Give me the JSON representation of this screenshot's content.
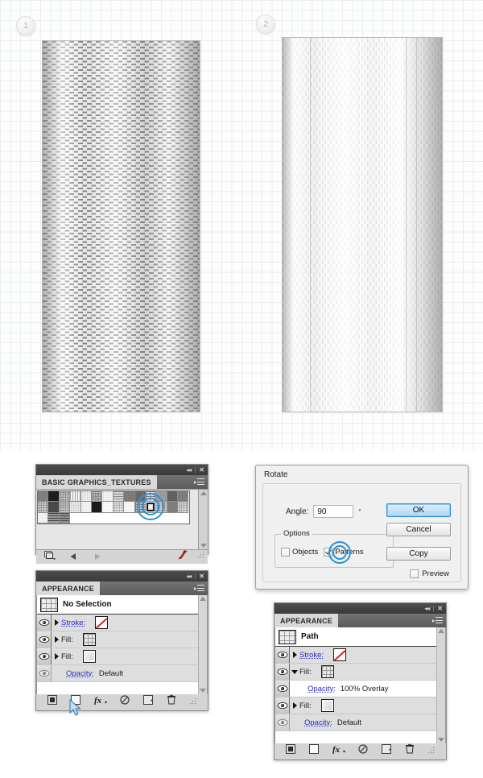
{
  "canvas": {
    "badges": [
      {
        "label": "1"
      },
      {
        "label": "2"
      }
    ],
    "artwork": [
      {
        "name": "textured-rectangle-original",
        "pattern": "horizontal-dashes"
      },
      {
        "name": "textured-rectangle-rotated",
        "pattern": "vertical-dashes"
      }
    ]
  },
  "swatch_panel": {
    "tab_label": "BASIC GRAPHICS_TEXTURES",
    "collapse_icon": "collapse-icon",
    "close_icon": "close-icon",
    "menu_icon": "panel-menu-icon",
    "footer": {
      "library_icon": "swatch-libraries-icon",
      "prev_icon": "previous-arrow-icon",
      "next_icon": "next-arrow-icon",
      "delete_icon": "delete-brush-icon"
    },
    "scroll": {
      "up_icon": "scroll-up-arrow",
      "down_icon": "scroll-down-arrow"
    },
    "selected_swatch_index": 24,
    "swatch_count": 31
  },
  "appearance_left": {
    "tab_label": "APPEARANCE",
    "collapse_icon": "collapse-icon",
    "close_icon": "close-icon",
    "menu_icon": "panel-menu-icon",
    "header_title": "No Selection",
    "rows": [
      {
        "label": "Stroke:",
        "value": "",
        "chip": "none",
        "link": true,
        "indent": 0,
        "expanded": false,
        "eye": true
      },
      {
        "label": "Fill:",
        "value": "",
        "chip": "grid",
        "link": false,
        "indent": 0,
        "expanded": false,
        "eye": true
      },
      {
        "label": "Fill:",
        "value": "",
        "chip": "solid",
        "link": false,
        "indent": 0,
        "expanded": false,
        "eye": true
      },
      {
        "label": "Opacity:",
        "value": "Default",
        "chip": "",
        "link": true,
        "indent": 0,
        "expanded": null,
        "eye": true
      }
    ],
    "footer": {
      "add_stroke_icon": "add-new-stroke-icon",
      "add_fill_icon": "add-new-fill-icon",
      "fx_icon": "add-effect-fx-icon",
      "clear_icon": "clear-appearance-icon",
      "duplicate_icon": "duplicate-item-icon",
      "delete_icon": "delete-item-trash-icon"
    }
  },
  "appearance_right": {
    "tab_label": "APPEARANCE",
    "collapse_icon": "collapse-icon",
    "close_icon": "close-icon",
    "menu_icon": "panel-menu-icon",
    "header_title": "Path",
    "rows": [
      {
        "label": "Stroke:",
        "value": "",
        "chip": "none",
        "link": true,
        "indent": 0,
        "expanded": false,
        "eye": true
      },
      {
        "label": "Fill:",
        "value": "",
        "chip": "grid",
        "link": false,
        "indent": 0,
        "expanded": true,
        "eye": true
      },
      {
        "label": "Opacity:",
        "value": "100% Overlay",
        "chip": "",
        "link": true,
        "indent": 1,
        "expanded": null,
        "eye": true
      },
      {
        "label": "Fill:",
        "value": "",
        "chip": "solid",
        "link": false,
        "indent": 0,
        "expanded": false,
        "eye": true
      },
      {
        "label": "Opacity:",
        "value": "Default",
        "chip": "",
        "link": true,
        "indent": 0,
        "expanded": null,
        "eye": true
      }
    ],
    "footer": {
      "add_stroke_icon": "add-new-stroke-icon",
      "add_fill_icon": "add-new-fill-icon",
      "fx_icon": "add-effect-fx-icon",
      "clear_icon": "clear-appearance-icon",
      "duplicate_icon": "duplicate-item-icon",
      "delete_icon": "delete-item-trash-icon"
    }
  },
  "rotate_dialog": {
    "title": "Rotate",
    "angle_label": "Angle:",
    "angle_value": "90",
    "degree_symbol": "°",
    "options_legend": "Options",
    "objects_label": "Objects",
    "objects_checked": false,
    "patterns_label": "Patterns",
    "patterns_checked": true,
    "preview_label": "Preview",
    "preview_checked": false,
    "ok_label": "OK",
    "cancel_label": "Cancel",
    "copy_label": "Copy"
  },
  "colors": {
    "accent_blue": "#2f8fd4",
    "link_blue": "#2a2ad0",
    "stroke_none_red": "#e02020",
    "panel_gray": "#d4d4d4",
    "titlebar_dark": "#3a3a3a"
  }
}
